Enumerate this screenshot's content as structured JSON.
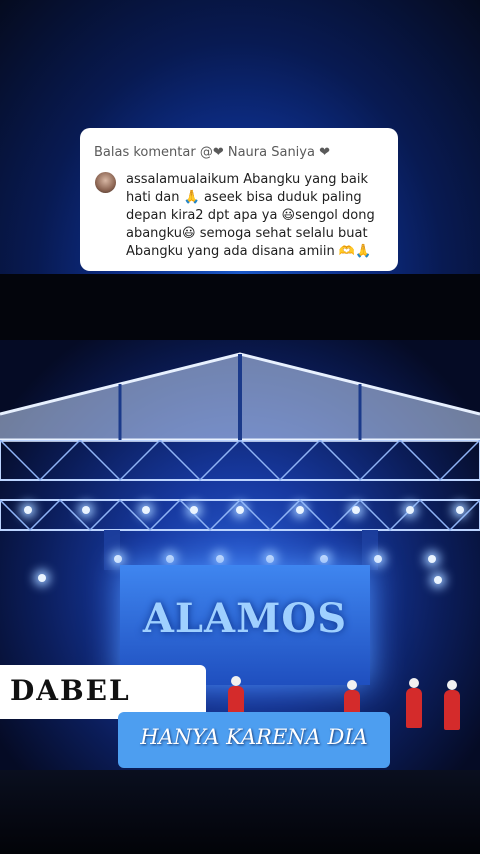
{
  "comment": {
    "header": "Balas komentar @❤ Naura Saniya ❤",
    "body": "assalamualaikum Abangku yang baik hati dan 🙏 aseek bisa duduk paling depan kira2 dpt apa ya 😃sengol dong abangku😃 semoga sehat selalu buat Abangku yang ada disana amiin 🫶🙏"
  },
  "stage_screen": {
    "text": "ALAMOS"
  },
  "overlay": {
    "artist": "DABEL",
    "song_title": "HANYA KARENA DIA"
  },
  "colors": {
    "song_badge": "#4d9ef0",
    "stage_blue": "#2b5fd6",
    "performer_red": "#d42b2b"
  }
}
